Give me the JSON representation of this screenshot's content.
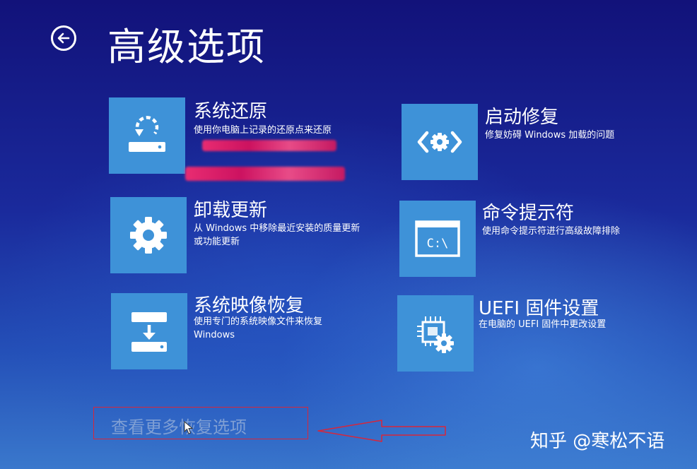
{
  "header": {
    "title": "高级选项"
  },
  "options": [
    {
      "id": "system-restore",
      "title": "系统还原",
      "desc": "使用你电脑上记录的还原点来还原"
    },
    {
      "id": "startup-repair",
      "title": "启动修复",
      "desc": "修复妨碍 Windows 加载的问题"
    },
    {
      "id": "uninstall-updates",
      "title": "卸载更新",
      "desc": "从 Windows 中移除最近安装的质量更新或功能更新"
    },
    {
      "id": "command-prompt",
      "title": "命令提示符",
      "desc": "使用命令提示符进行高级故障排除"
    },
    {
      "id": "system-image-recovery",
      "title": "系统映像恢复",
      "desc": "使用专门的系统映像文件来恢复 Windows"
    },
    {
      "id": "uefi-settings",
      "title": "UEFI 固件设置",
      "desc": "在电脑的 UEFI 固件中更改设置"
    }
  ],
  "more_link": "查看更多恢复选项",
  "watermark": "知乎 @寒松不语",
  "icons": [
    "back-arrow-icon",
    "restore-icon",
    "startup-repair-icon",
    "gear-icon",
    "command-prompt-icon",
    "system-image-icon",
    "uefi-chip-gear-icon"
  ],
  "colors": {
    "tile": "#3e92d8",
    "annotation": "#d8263a",
    "link_disabled": "#7f9fd4"
  }
}
